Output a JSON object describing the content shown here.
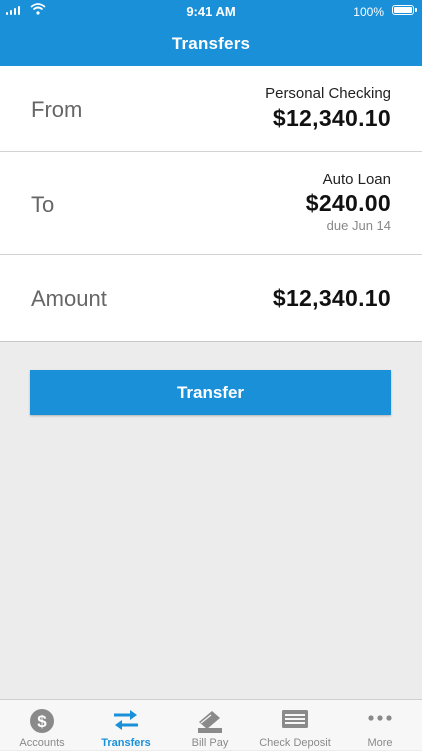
{
  "status_bar": {
    "time": "9:41 AM",
    "battery": "100%"
  },
  "header": {
    "title": "Transfers"
  },
  "from": {
    "label": "From",
    "account": "Personal Checking",
    "amount": "$12,340.10"
  },
  "to": {
    "label": "To",
    "account": "Auto Loan",
    "amount": "$240.00",
    "due": "due Jun 14"
  },
  "amount": {
    "label": "Amount",
    "value": "$12,340.10"
  },
  "transfer_button": {
    "label": "Transfer"
  },
  "tabs": [
    {
      "label": "Accounts",
      "icon": "dollar-circle-icon",
      "active": false
    },
    {
      "label": "Transfers",
      "icon": "transfer-arrows-icon",
      "active": true
    },
    {
      "label": "Bill Pay",
      "icon": "bill-pay-icon",
      "active": false
    },
    {
      "label": "Check Deposit",
      "icon": "check-icon",
      "active": false
    },
    {
      "label": "More",
      "icon": "more-dots-icon",
      "active": false
    }
  ],
  "colors": {
    "accent": "#1a90d9",
    "background": "#ececec",
    "tab_inactive": "#8a8a8a"
  }
}
